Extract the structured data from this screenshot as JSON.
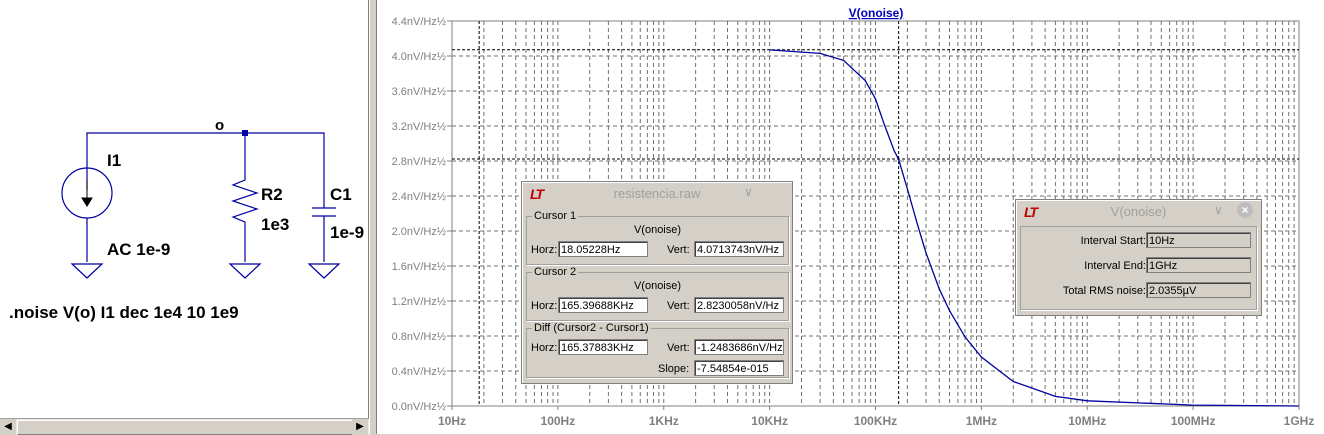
{
  "schematic": {
    "node_label": "o",
    "source": {
      "name": "I1",
      "value": "AC 1e-9"
    },
    "resistor": {
      "name": "R2",
      "value": "1e3"
    },
    "capacitor": {
      "name": "C1",
      "value": "1e-9"
    },
    "directive": ".noise V(o) I1 dec 1e4 10 1e9"
  },
  "plot": {
    "trace_title": "V(onoise)",
    "y_ticks": [
      "0.0nV/Hz½",
      "0.4nV/Hz½",
      "0.8nV/Hz½",
      "1.2nV/Hz½",
      "1.6nV/Hz½",
      "2.0nV/Hz½",
      "2.4nV/Hz½",
      "2.8nV/Hz½",
      "3.2nV/Hz½",
      "3.6nV/Hz½",
      "4.0nV/Hz½",
      "4.4nV/Hz½"
    ],
    "x_ticks": [
      "10Hz",
      "100Hz",
      "1KHz",
      "10KHz",
      "100KHz",
      "1MHz",
      "10MHz",
      "100MHz",
      "1GHz"
    ]
  },
  "chart_data": {
    "type": "line",
    "title": "V(onoise)",
    "x_scale": "log",
    "xlim": [
      10,
      1000000000
    ],
    "ylim": [
      0,
      4.4
    ],
    "y_unit": "nV/Hz½",
    "grid": true,
    "series": [
      {
        "name": "V(onoise)",
        "color": "#0000a0",
        "x": [
          10000,
          30000,
          50000,
          80000,
          100000,
          120000,
          150000,
          165397,
          200000,
          250000,
          300000,
          400000,
          500000,
          700000,
          1000000,
          2000000,
          5000000,
          10000000,
          100000000,
          1000000000
        ],
        "y": [
          4.07,
          4.03,
          3.95,
          3.72,
          3.51,
          3.23,
          2.92,
          2.82,
          2.48,
          2.07,
          1.75,
          1.34,
          1.09,
          0.79,
          0.56,
          0.28,
          0.11,
          0.06,
          0.01,
          0.0
        ]
      }
    ],
    "cursors": [
      {
        "name": "Cursor 1",
        "x": 18.05228,
        "y": 4.0713743
      },
      {
        "name": "Cursor 2",
        "x": 165396.88,
        "y": 2.8230058
      }
    ]
  },
  "cursor_window": {
    "title": "resistencia.raw",
    "cursor1": {
      "label": "Cursor 1",
      "trace": "V(onoise)",
      "horz_label": "Horz:",
      "horz": "18.05228Hz",
      "vert_label": "Vert:",
      "vert": "4.0713743nV/Hz"
    },
    "cursor2": {
      "label": "Cursor 2",
      "trace": "V(onoise)",
      "horz_label": "Horz:",
      "horz": "165.39688KHz",
      "vert_label": "Vert:",
      "vert": "2.8230058nV/Hz"
    },
    "diff": {
      "label": "Diff (Cursor2 - Cursor1)",
      "horz_label": "Horz:",
      "horz": "165.37883KHz",
      "vert_label": "Vert:",
      "vert": "-1.2483686nV/Hz",
      "slope_label": "Slope:",
      "slope": "-7.54854e-015"
    }
  },
  "rms_window": {
    "title": "V(onoise)",
    "interval_start_label": "Interval Start:",
    "interval_start": "10Hz",
    "interval_end_label": "Interval End:",
    "interval_end": "1GHz",
    "total_rms_label": "Total RMS noise:",
    "total_rms": "2.0355µV"
  },
  "icons": {
    "app_logo": "ltspice-logo-icon",
    "chevron": "chevron-down-icon",
    "close": "close-icon"
  },
  "colors": {
    "trace": "#0000a0",
    "title_link": "#0000c0",
    "logo": "#c00000"
  }
}
